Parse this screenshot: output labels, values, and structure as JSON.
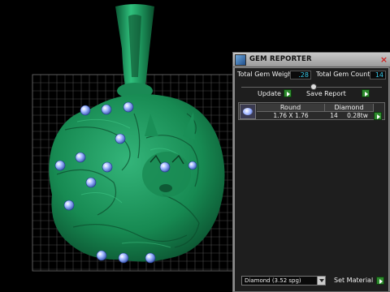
{
  "panel": {
    "title": "GEM REPORTER",
    "close_glyph": "×",
    "total_gem_weight_label": "Total Gem Weight",
    "total_gem_weight_value": ".28",
    "total_gem_count_label": "Total Gem Count",
    "total_gem_count_value": "14",
    "update_label": "Update",
    "save_report_label": "Save Report",
    "table": {
      "headers": [
        "Round",
        "Diamond"
      ],
      "row": {
        "size": "1.76 X 1.76",
        "count": "14",
        "weight": "0.28tw"
      }
    },
    "material_value": "Diamond     (3.52 spg)",
    "set_material_label": "Set Material"
  },
  "colors": {
    "model_green": "#1f9a5e",
    "gem_blue": "#7aa0ff",
    "panel_value_text": "#38c8e8",
    "go_green": "#2e8b2e"
  },
  "icons": {
    "panel": "gem-reporter-icon",
    "close": "close-icon",
    "go": "play-arrow-icon",
    "dropdown": "chevron-down-icon"
  }
}
